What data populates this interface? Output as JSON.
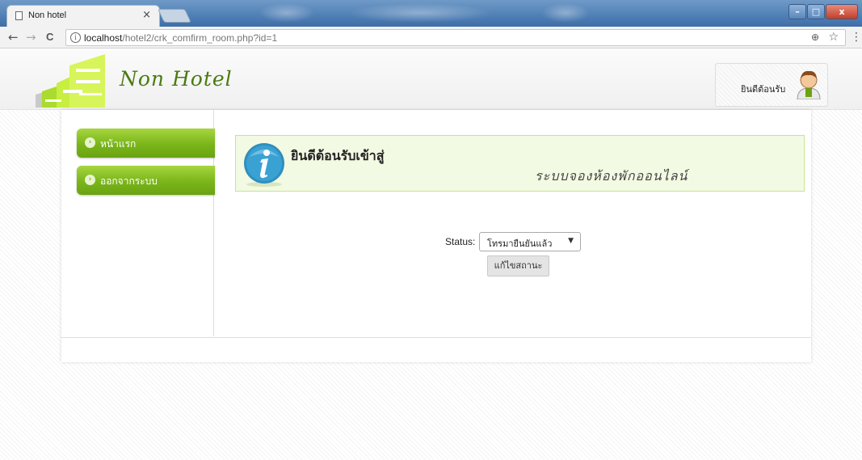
{
  "browser": {
    "tab_title": "Non hotel",
    "tab_close": "×",
    "url_host": "localhost",
    "url_path": "/hotel2/crk_comfirm_room.php?id=1",
    "back_glyph": "←",
    "forward_glyph": "→",
    "reload_glyph": "C",
    "info_glyph": "i",
    "zoom_glyph": "⊕",
    "star_glyph": "☆",
    "menu_glyph": "⋮",
    "window_controls": {
      "minimize": "–",
      "maximize": "□",
      "close": "x"
    }
  },
  "header": {
    "site_name": "Non Hotel",
    "welcome_text": "ยินดีต้อนรับ",
    "brand_color": "#8cc21c"
  },
  "sidebar": {
    "items": [
      {
        "label": "หน้าแรก",
        "icon": "chevron-right-icon"
      },
      {
        "label": "ออกจากระบบ",
        "icon": "chevron-right-icon"
      }
    ]
  },
  "main": {
    "panel_title": "ยินดีต้อนรับเข้าสู่",
    "panel_subtitle": "ระบบจองห้องพักออนไลน์",
    "status_label": "Status:",
    "status_value": "โทรมายืนยันแล้ว",
    "status_chevron": "▼",
    "edit_button_label": "แก้ไขสถานะ"
  }
}
